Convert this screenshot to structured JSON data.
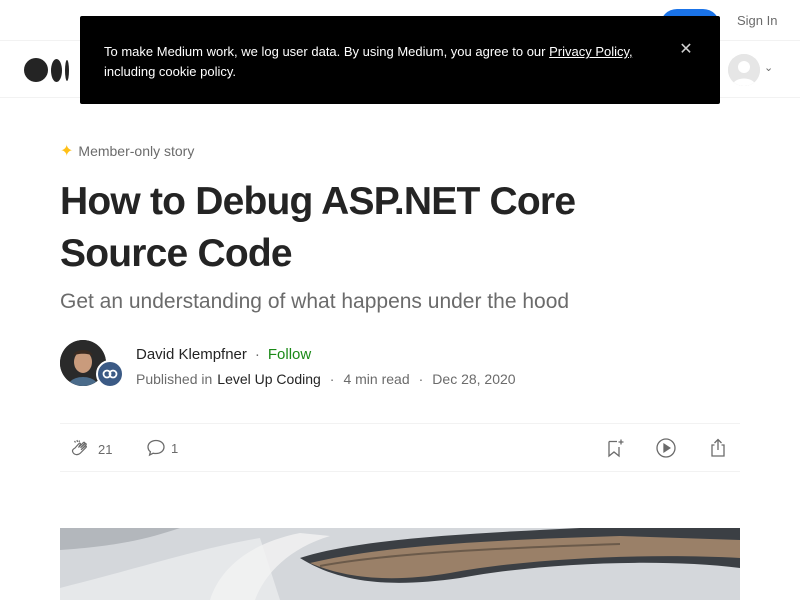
{
  "topbar": {
    "signin_label": "Sign In"
  },
  "cookie_banner": {
    "text_before": "To make Medium work, we log user data. By using Medium, you agree to our ",
    "privacy_link": "Privacy Policy,",
    "text_after": " including cookie policy.",
    "close_label": "✕"
  },
  "article": {
    "member_label": "Member-only story",
    "title": "How to Debug ASP.NET Core Source Code",
    "subtitle": "Get an understanding of what happens under the hood",
    "author_name": "David Klempfner",
    "follow_label": "Follow",
    "published_in": "Published in",
    "publication": "Level Up Coding",
    "read_time": "4 min read",
    "date": "Dec 28, 2020",
    "claps": "21",
    "comments": "1"
  },
  "colors": {
    "follow": "#1a8917",
    "star": "#ffc017",
    "banner": "#000000"
  },
  "icons": [
    "medium-logo-icon",
    "user-avatar-icon",
    "chevron-down-icon",
    "close-icon",
    "star-icon",
    "clap-icon",
    "comment-icon",
    "bookmark-add-icon",
    "play-icon",
    "share-icon"
  ]
}
